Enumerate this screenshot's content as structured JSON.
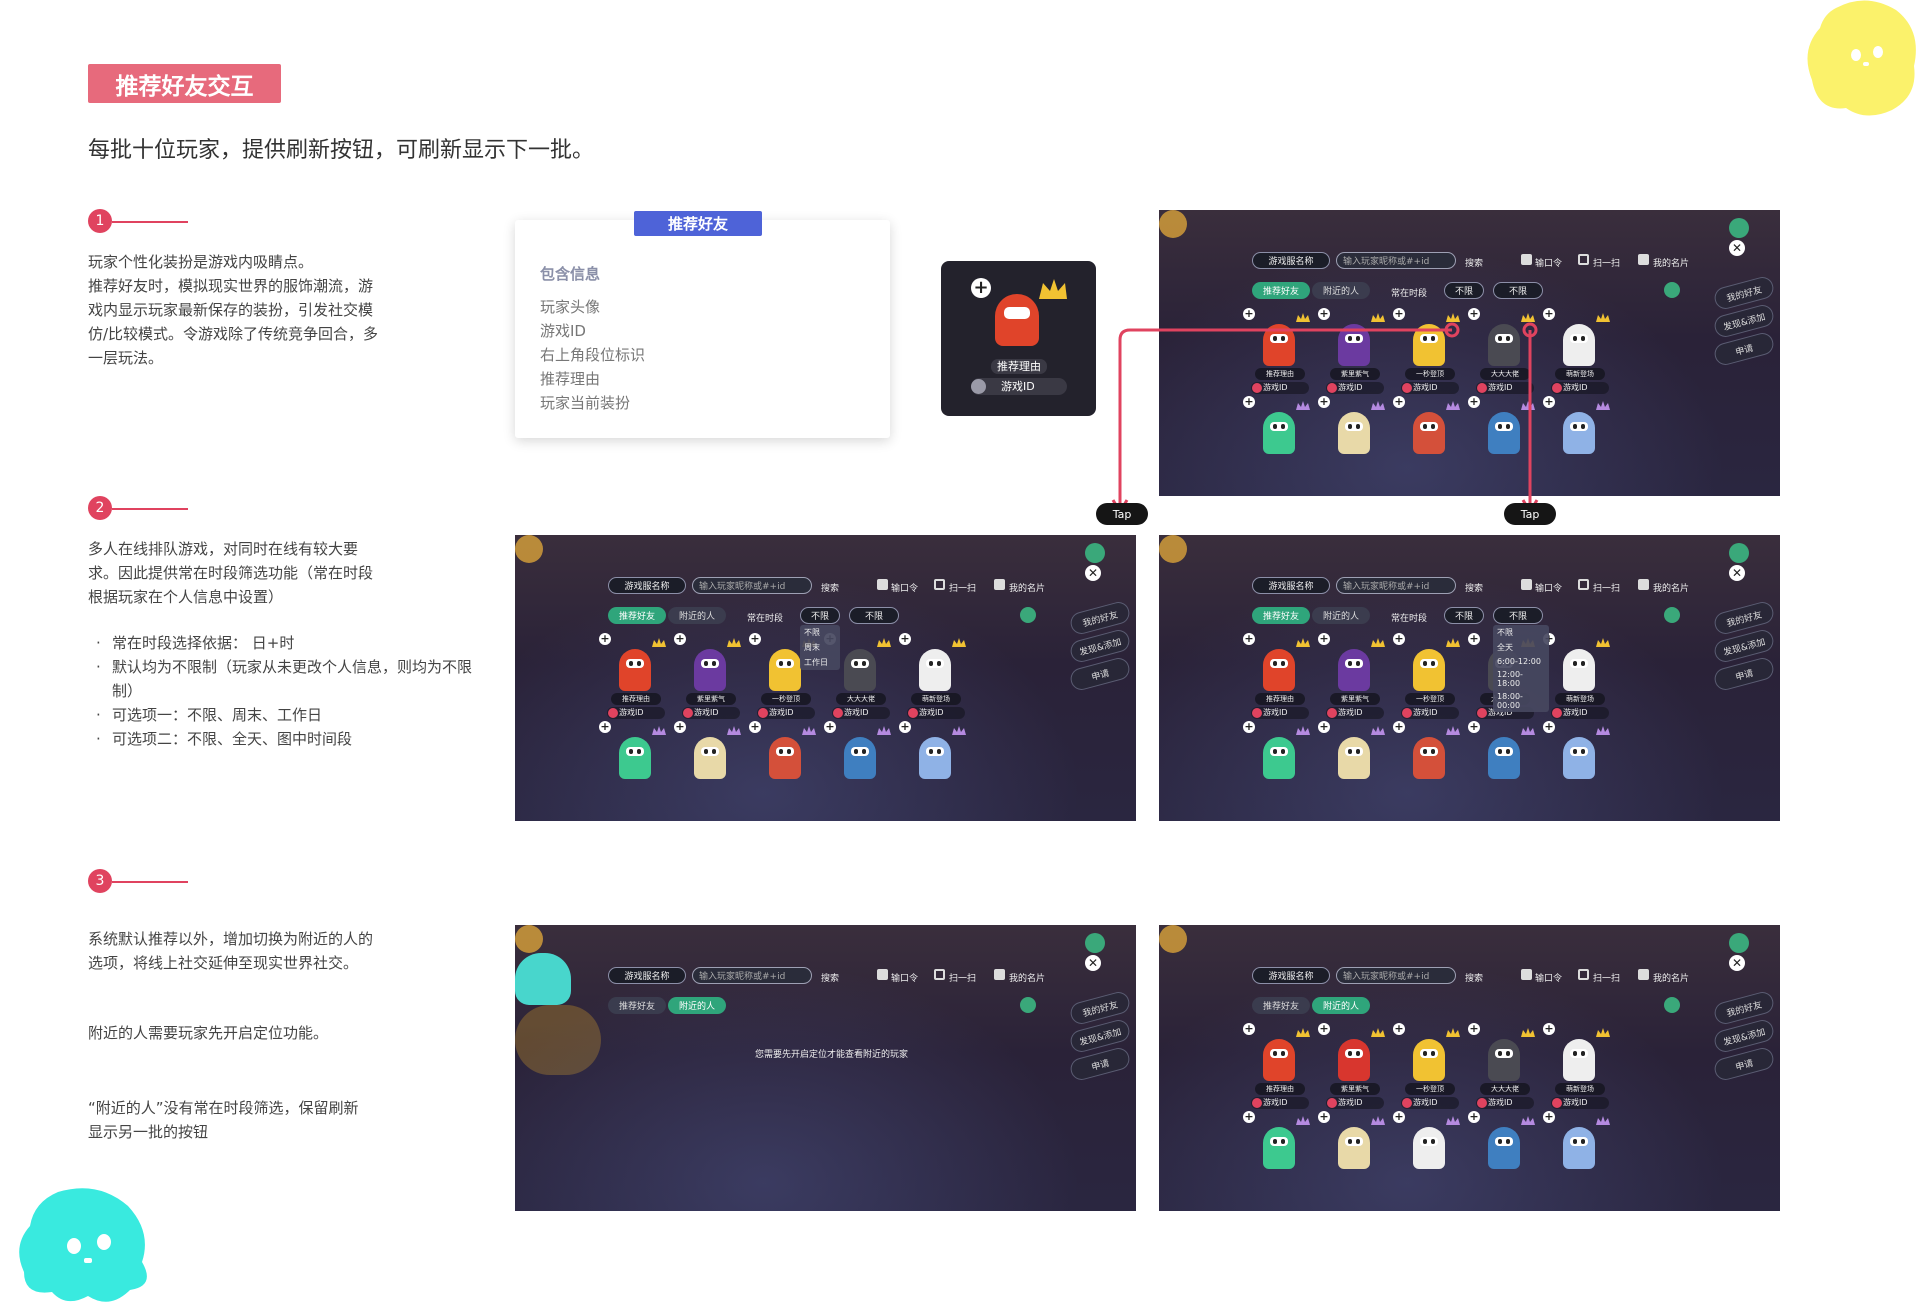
{
  "title": "推荐好友交互",
  "subtitle": "每批十位玩家，提供刷新按钮，可刷新显示下一批。",
  "colors": {
    "accent": "#e0435f",
    "badge": "#e76a7c",
    "tab_blue": "#4e63d8",
    "connector": "#e0435f"
  },
  "steps": [
    {
      "num": "1",
      "lines": [
        "玩家个性化装扮是游戏内吸睛点。",
        "推荐好友时，模拟现实世界的服饰潮流，游",
        "戏内显示玩家最新保存的装扮，引发社交模",
        "仿/比较模式。令游戏除了传统竞争回合，多",
        "一层玩法。"
      ]
    },
    {
      "num": "2",
      "lines": [
        "多人在线排队游戏，对同时在线有较大要",
        "求。因此提供常在时段筛选功能（常在时段",
        "根据玩家在个人信息中设置）"
      ],
      "bullets": [
        "常在时段选择依据： 日+时",
        "默认均为不限制（玩家从未更改个人信息，则均为不限制）",
        "可选项一：不限、周末、工作日",
        "可选项二：不限、全天、图中时间段"
      ]
    },
    {
      "num": "3",
      "lines": [
        "系统默认推荐以外，增加切换为附近的人的",
        "选项，将线上社交延伸至现实世界社交。"
      ],
      "line2": "附近的人需要玩家先开启定位功能。",
      "line3": [
        "“附近的人”没有常在时段筛选，保留刷新",
        "显示另一批的按钮"
      ]
    }
  ],
  "info_card": {
    "tab": "推荐好友",
    "heading": "包含信息",
    "items": [
      "玩家头像",
      "游戏ID",
      "右上角段位标识",
      "推荐理由",
      "玩家当前装扮"
    ]
  },
  "avatar_card": {
    "reason": "推荐理由",
    "game_id": "游戏ID"
  },
  "ui": {
    "game_name": "游戏服名称",
    "search_placeholder": "输入玩家昵称或#+id",
    "search_btn": "搜索",
    "invite_code": "输口令",
    "scan": "扫一扫",
    "my_card": "我的名片",
    "tab_recommend": "推荐好友",
    "tab_nearby": "附近的人",
    "online_period": "常在时段",
    "filter1": "不限",
    "filter2": "不限",
    "close": "✕",
    "side": [
      "我的好友",
      "发现&添加",
      "申请"
    ],
    "game_id_label": "游戏ID",
    "location_notice": "您需要先开启定位才能查看附近的玩家"
  },
  "menu1": [
    "不限",
    "周末",
    "工作日"
  ],
  "menu2": [
    "不限",
    "全天",
    "6:00-12:00",
    "12:00-18:00",
    "18:00-00:00"
  ],
  "tap_label": "Tap",
  "players_a": [
    {
      "reason": "推荐理由",
      "color": "#e0442a"
    },
    {
      "reason": "紫里紫气",
      "color": "#6b3aa0"
    },
    {
      "reason": "一秒登顶",
      "color": "#f1c232"
    },
    {
      "reason": "大大大佬",
      "color": "#4a4a52"
    },
    {
      "reason": "萌新登场",
      "color": "#eeeeee"
    }
  ],
  "players_b": [
    {
      "color": "#3dc98f"
    },
    {
      "color": "#e8d9a8"
    },
    {
      "color": "#d4503a"
    },
    {
      "color": "#3f7fc0"
    },
    {
      "color": "#8fb2e6"
    }
  ],
  "players_nearby_top": [
    {
      "reason": "推荐理由",
      "color": "#e0442a"
    },
    {
      "reason": "紫里紫气",
      "color": "#d8362e"
    },
    {
      "reason": "一秒登顶",
      "color": "#f1c232"
    },
    {
      "reason": "大大大佬",
      "color": "#4a4a52"
    },
    {
      "reason": "萌新登场",
      "color": "#eeeeee"
    }
  ],
  "players_nearby_bottom": [
    {
      "color": "#3dc98f"
    },
    {
      "color": "#e8d9a8"
    },
    {
      "color": "#eeeeee"
    },
    {
      "color": "#3f7fc0"
    },
    {
      "color": "#8fb2e6"
    }
  ]
}
